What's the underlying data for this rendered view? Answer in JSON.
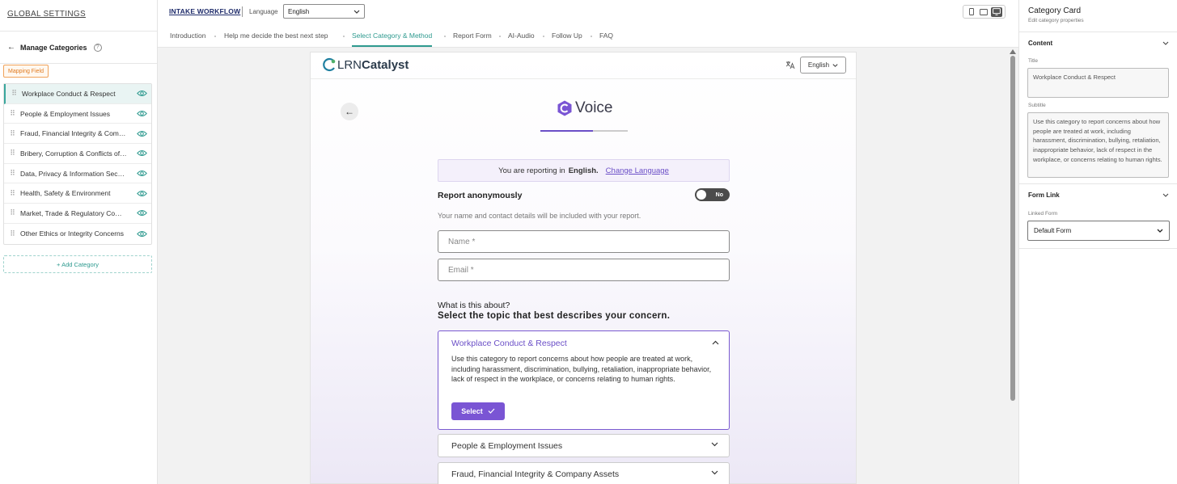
{
  "sidebar": {
    "title": "GLOBAL SETTINGS",
    "manage_label": "Manage Categories",
    "mapping_field": "Mapping Field",
    "add_category": "+ Add Category",
    "categories": [
      {
        "label": "Workplace Conduct & Respect"
      },
      {
        "label": "People & Employment Issues"
      },
      {
        "label": "Fraud, Financial Integrity & Company Assets"
      },
      {
        "label": "Bribery, Corruption & Conflicts of Interest"
      },
      {
        "label": "Data, Privacy & Information Security"
      },
      {
        "label": "Health, Safety & Environment"
      },
      {
        "label": "Market, Trade & Regulatory Compliance"
      },
      {
        "label": "Other Ethics or Integrity Concerns"
      }
    ]
  },
  "header": {
    "workflow_link": "INTAKE WORKFLOW",
    "language_label": "Language",
    "language_value": "English"
  },
  "tabs": [
    {
      "label": "Introduction"
    },
    {
      "label": "Help me decide the best next step"
    },
    {
      "label": "Select Category & Method"
    },
    {
      "label": "Report Form"
    },
    {
      "label": "AI-Audio"
    },
    {
      "label": "Follow Up"
    },
    {
      "label": "FAQ"
    }
  ],
  "preview": {
    "logo_lrn": "LRN",
    "logo_catalyst": "Catalyst",
    "language_button": "English",
    "voice_title": "Voice",
    "progress": 0.6,
    "reporting_prefix": "You are reporting in",
    "reporting_lang": "English.",
    "change_language": "Change Language",
    "anon_label": "Report anonymously",
    "toggle_state": "No",
    "anon_desc": "Your name and contact details will be included with your report.",
    "name_placeholder": "Name *",
    "email_placeholder": "Email *",
    "question": "What is this about?",
    "question_bold": "Select the topic that best describes your concern.",
    "open_card": {
      "title": "Workplace Conduct & Respect",
      "description": "Use this category to report concerns about how people are treated at work, including harassment, discrimination, bullying, retaliation, inappropriate behavior, lack of respect in the workplace, or concerns relating to human rights.",
      "select_label": "Select"
    },
    "collapsed_cards": [
      {
        "title": "People & Employment Issues"
      },
      {
        "title": "Fraud, Financial Integrity & Company Assets"
      }
    ]
  },
  "panel": {
    "title": "Category Card",
    "subtitle": "Edit category properties",
    "content_section": "Content",
    "title_label": "Title",
    "title_value": "Workplace Conduct & Respect",
    "subtitle_label": "Subtitle",
    "subtitle_value": "Use this category to report concerns about how people are treated at work, including harassment, discrimination, bullying, retaliation, inappropriate behavior, lack of respect in the workplace, or concerns relating to human rights.",
    "form_link_section": "Form Link",
    "linked_form_label": "Linked Form",
    "linked_form_value": "Default Form"
  },
  "colors": {
    "accent_teal": "#2e9a8f",
    "accent_purple": "#6b4fc7",
    "mapping_orange": "#e07a1f"
  }
}
